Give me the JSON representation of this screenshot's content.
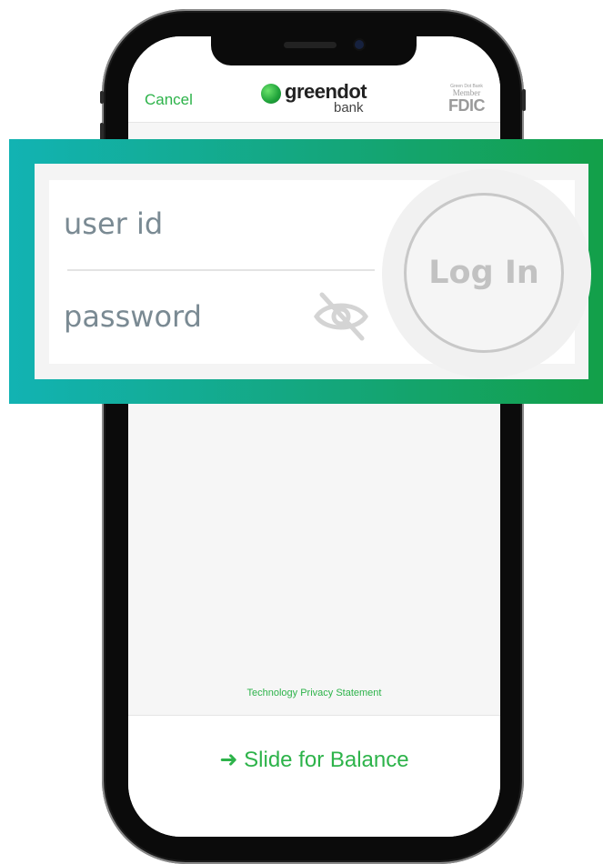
{
  "header": {
    "cancel_label": "Cancel",
    "logo_word": "greendot",
    "logo_sub": "bank",
    "fdic_top": "Green Dot Bank",
    "fdic_member": "Member",
    "fdic_main": "FDIC"
  },
  "login": {
    "user_placeholder": "user id",
    "password_placeholder": "password",
    "password_visibility_icon": "eye-off-icon",
    "login_label": "Log In"
  },
  "footer": {
    "privacy_link": "Technology Privacy Statement",
    "slide_label": "Slide for Balance",
    "slide_icon": "arrow-right-icon"
  },
  "colors": {
    "brand_green": "#2db34a",
    "highlight_start": "#12b3b3",
    "highlight_end": "#13a049",
    "placeholder_gray": "#7a8a93"
  }
}
